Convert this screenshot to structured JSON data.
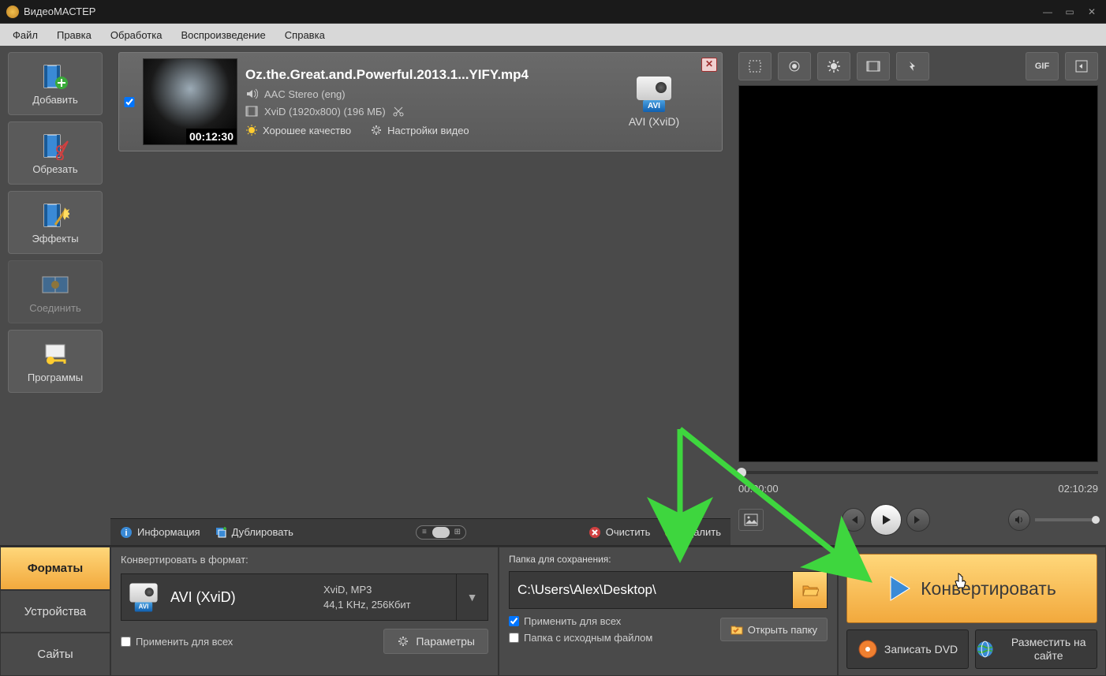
{
  "titlebar": {
    "title": "ВидеоМАСТЕР"
  },
  "menu": {
    "file": "Файл",
    "edit": "Правка",
    "process": "Обработка",
    "play": "Воспроизведение",
    "help": "Справка"
  },
  "sidebar": {
    "add": "Добавить",
    "cut": "Обрезать",
    "effects": "Эффекты",
    "join": "Соединить",
    "programs": "Программы"
  },
  "file": {
    "name": "Oz.the.Great.and.Powerful.2013.1...YIFY.mp4",
    "duration": "00:12:30",
    "audio": "AAC Stereo (eng)",
    "video": "XviD (1920x800) (196 МБ)",
    "quality": "Хорошее качество",
    "settings": "Настройки видео",
    "out_format": "AVI (XviD)",
    "out_badge": "AVI"
  },
  "actionbar": {
    "info": "Информация",
    "dup": "Дублировать",
    "clear": "Очистить",
    "del": "Удалить"
  },
  "preview": {
    "cur": "00:00:00",
    "total": "02:10:29"
  },
  "bottom": {
    "tabs": {
      "formats": "Форматы",
      "devices": "Устройства",
      "sites": "Сайты"
    },
    "fmt_hdr": "Конвертировать в формат:",
    "fmt_name": "AVI (XviD)",
    "fmt_badge": "AVI",
    "fmt_line1": "XviD, MP3",
    "fmt_line2": "44,1 KHz, 256Кбит",
    "apply_all": "Применить для всех",
    "params": "Параметры",
    "save_hdr": "Папка для сохранения:",
    "save_path": "C:\\Users\\Alex\\Desktop\\",
    "apply_all2": "Применить для всех",
    "src_folder": "Папка с исходным файлом",
    "open_folder": "Открыть папку",
    "convert": "Конвертировать",
    "burn": "Записать DVD",
    "publish": "Разместить на сайте"
  }
}
